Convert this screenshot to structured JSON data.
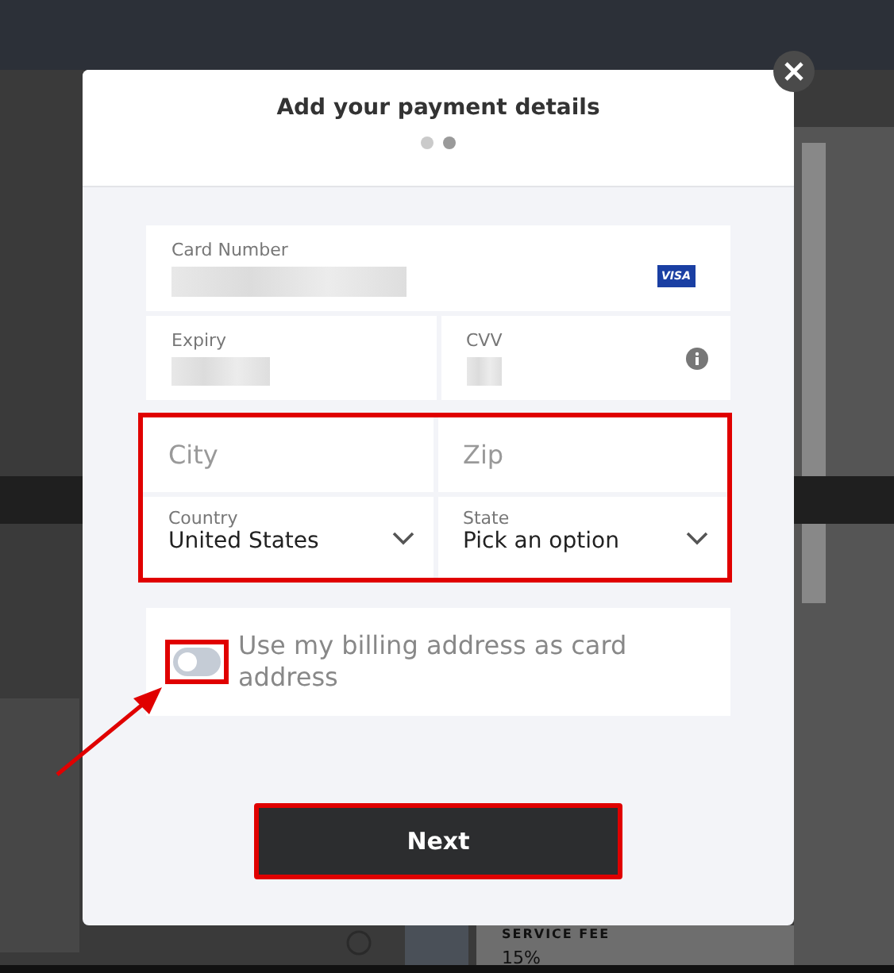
{
  "dialog": {
    "title": "Add your payment details",
    "steps": [
      {
        "selected": false
      },
      {
        "selected": true
      }
    ],
    "card_number": {
      "label": "Card Number",
      "brand": "VISA"
    },
    "expiry": {
      "label": "Expiry"
    },
    "cvv": {
      "label": "CVV"
    },
    "city": {
      "placeholder": "City"
    },
    "zip": {
      "placeholder": "Zip"
    },
    "country": {
      "label": "Country",
      "value": "United States"
    },
    "state": {
      "label": "State",
      "value": "Pick an option"
    },
    "billing_toggle": {
      "label": "Use my billing address as card address",
      "on": false
    },
    "next_button": "Next"
  },
  "background": {
    "fee_label": "SERVICE FEE",
    "fee_value": "15%"
  }
}
